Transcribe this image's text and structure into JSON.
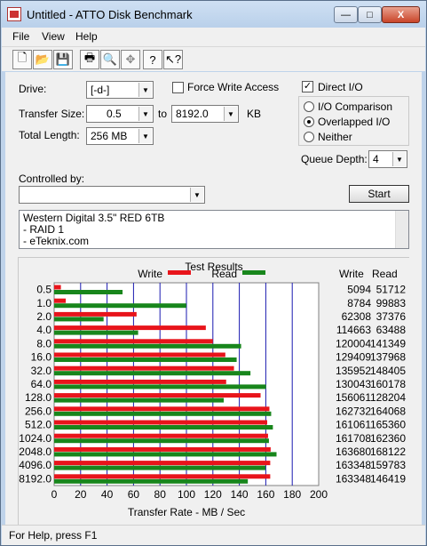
{
  "window": {
    "title": "Untitled - ATTO Disk Benchmark",
    "buttons": {
      "minimize": "—",
      "maximize": "□",
      "close": "X"
    }
  },
  "menu": [
    "File",
    "View",
    "Help"
  ],
  "toolbar": [
    "new-icon",
    "open-icon",
    "save-icon",
    "print-icon",
    "print-preview-icon",
    "move-icon",
    "help-icon",
    "context-help-icon"
  ],
  "form": {
    "drive_label": "Drive:",
    "drive_value": "[-d-]",
    "force_write_label": "Force Write Access",
    "force_write_checked": false,
    "direct_io_label": "Direct I/O",
    "direct_io_checked": true,
    "transfer_size_label": "Transfer Size:",
    "transfer_from": "0.5",
    "to_label": "to",
    "transfer_to": "8192.0",
    "kb_label": "KB",
    "total_length_label": "Total Length:",
    "total_length_value": "256 MB",
    "io_options": [
      "I/O Comparison",
      "Overlapped I/O",
      "Neither"
    ],
    "io_selected": "Overlapped I/O",
    "queue_depth_label": "Queue Depth:",
    "queue_depth_value": "4",
    "controlled_by_label": "Controlled by:",
    "controlled_by_value": "",
    "start_label": "Start",
    "description_lines": [
      "Western Digital 3.5\" RED 6TB",
      "- RAID 1",
      "- eTeknix.com"
    ]
  },
  "results": {
    "group_title": "Test Results",
    "legend_write": "Write",
    "legend_read": "Read",
    "col_write": "Write",
    "col_read": "Read",
    "write_color": "#e8141b",
    "read_color": "#18861c"
  },
  "chart_data": {
    "type": "bar",
    "orientation": "horizontal",
    "categories": [
      "0.5",
      "1.0",
      "2.0",
      "4.0",
      "8.0",
      "16.0",
      "32.0",
      "64.0",
      "128.0",
      "256.0",
      "512.0",
      "1024.0",
      "2048.0",
      "4096.0",
      "8192.0"
    ],
    "series": [
      {
        "name": "Write",
        "values": [
          5094,
          8784,
          62308,
          114663,
          120004,
          129409,
          135952,
          130043,
          156061,
          162732,
          161061,
          161708,
          163680,
          163348,
          163348
        ]
      },
      {
        "name": "Read",
        "values": [
          51712,
          99883,
          37376,
          63488,
          141349,
          137968,
          148405,
          160178,
          128204,
          164068,
          165360,
          162360,
          168122,
          159783,
          146419
        ]
      }
    ],
    "xlabel": "Transfer Rate - MB / Sec",
    "xticks": [
      0,
      20,
      40,
      60,
      80,
      100,
      120,
      140,
      160,
      180,
      200
    ],
    "xlim": [
      0,
      200
    ],
    "grid": true,
    "legend_position": "top"
  },
  "status": "For Help, press F1"
}
